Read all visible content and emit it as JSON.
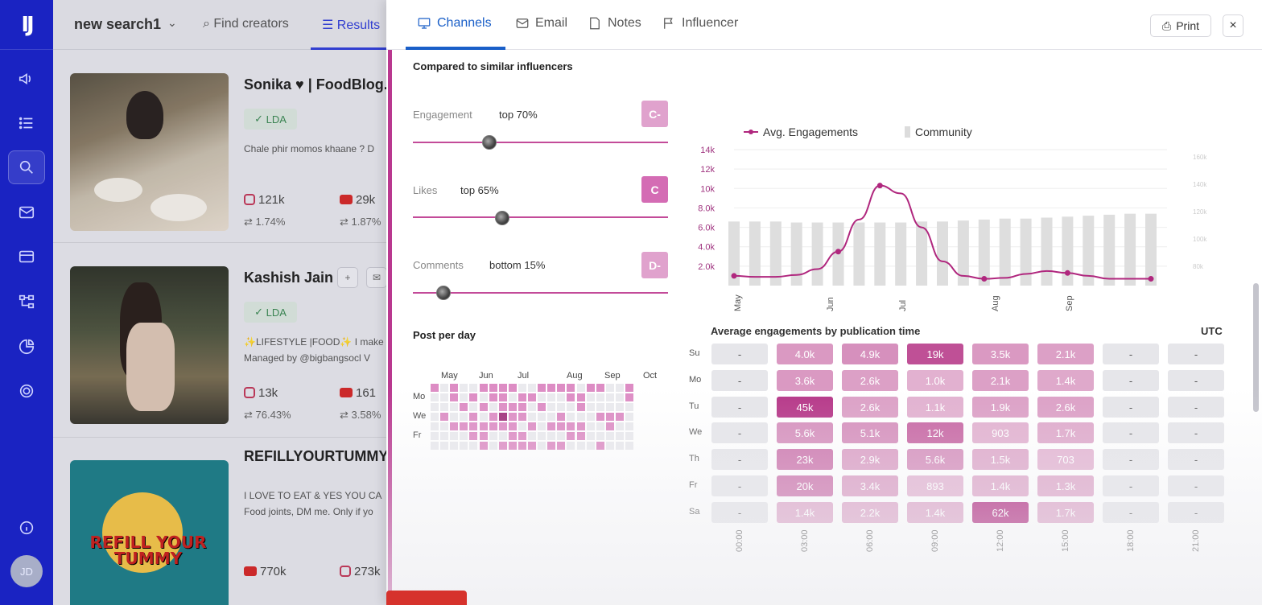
{
  "sidebar": {
    "logo": "IJ",
    "avatar_initials": "JD"
  },
  "results": {
    "search_name": "new search1",
    "find_tab": "Find creators",
    "results_tab": "Results",
    "cards": [
      {
        "name": "Sonika ♥ | FoodBlog...",
        "badge": "LDA",
        "bio": "Chale phir momos khaane ? D",
        "bio2": "",
        "ig_followers": "121k",
        "yt_followers": "29k",
        "ig_engagement": "1.74%",
        "yt_engagement": "1.87%"
      },
      {
        "name": "Kashish Jain",
        "badge": "LDA",
        "bio": "✨LIFESTYLE |FOOD✨ I make",
        "bio2": "Managed by @bigbangsocl V",
        "ig_followers": "13k",
        "yt_followers": "161",
        "ig_engagement": "76.43%",
        "yt_engagement": "3.58%"
      },
      {
        "name": "REFILLYOURTUMMY",
        "badge": "",
        "bio": "I LOVE TO EAT & YES YOU CA",
        "bio2": "Food joints, DM me. Only if yo",
        "yt_followers": "770k",
        "ig_followers": "273k"
      }
    ],
    "card3_image_text": "REFILL YOUR TUMMY"
  },
  "drawer": {
    "tabs": [
      "Channels",
      "Email",
      "Notes",
      "Influencer"
    ],
    "print_label": "Print",
    "close_label": "×",
    "compared_title": "Compared to similar influencers",
    "metrics": [
      {
        "label": "Engagement",
        "value": "top 70%",
        "grade": "C-",
        "position": 0.3
      },
      {
        "label": "Likes",
        "value": "top 65%",
        "grade": "C",
        "position": 0.35
      },
      {
        "label": "Comments",
        "value": "bottom 15%",
        "grade": "D-",
        "position": 0.12
      }
    ],
    "post_per_day_title": "Post per day",
    "calendar": {
      "months": [
        "May",
        "Jun",
        "Jul",
        "Aug",
        "Sep",
        "Oct"
      ],
      "days": [
        "Mo",
        "We",
        "Fr"
      ]
    }
  },
  "chart_data": {
    "type": "line",
    "legend": [
      "Avg. Engagements",
      "Community"
    ],
    "x_ticks": [
      "May",
      "Jun",
      "Jul",
      "Aug",
      "Sep"
    ],
    "y_ticks": [
      "2.0k",
      "4.0k",
      "6.0k",
      "8.0k",
      "10k",
      "12k",
      "14k"
    ],
    "ylim": [
      0,
      14000
    ],
    "series": [
      {
        "name": "Avg. Engagements",
        "x": [
          0,
          0.25,
          0.5,
          0.75,
          1.0,
          1.25,
          1.5,
          1.75,
          2.0,
          2.25,
          2.5,
          2.75,
          3.0,
          3.25,
          3.5,
          3.75,
          4.0,
          4.25,
          4.5,
          4.75,
          5.0
        ],
        "values": [
          1000,
          900,
          900,
          1100,
          1700,
          3500,
          6800,
          10300,
          9500,
          6000,
          2500,
          1000,
          700,
          800,
          1200,
          1500,
          1300,
          1000,
          700,
          700,
          700
        ]
      },
      {
        "name": "Community",
        "values": [
          6600,
          6600,
          6600,
          6500,
          6500,
          6500,
          6500,
          6500,
          6500,
          6600,
          6600,
          6700,
          6800,
          6900,
          6900,
          7000,
          7100,
          7200,
          7300,
          7400,
          7400
        ]
      }
    ],
    "marker_indices": [
      0,
      5,
      7,
      12,
      16,
      20
    ],
    "secondary_ticks": [
      "160k",
      "140k",
      "120k",
      "100k",
      "80k"
    ]
  },
  "heatmap": {
    "title": "Average engagements by publication time",
    "timezone": "UTC",
    "rows": [
      "Su",
      "Mo",
      "Tu",
      "We",
      "Th",
      "Fr",
      "Sa"
    ],
    "cols": [
      "00:00",
      "03:00",
      "06:00",
      "09:00",
      "12:00",
      "15:00",
      "18:00",
      "21:00"
    ],
    "values": [
      [
        "-",
        "4.0k",
        "4.9k",
        "19k",
        "3.5k",
        "2.1k",
        "-",
        "-"
      ],
      [
        "-",
        "3.6k",
        "2.6k",
        "1.0k",
        "2.1k",
        "1.4k",
        "-",
        "-"
      ],
      [
        "-",
        "45k",
        "2.6k",
        "1.1k",
        "1.9k",
        "2.6k",
        "-",
        "-"
      ],
      [
        "-",
        "5.6k",
        "5.1k",
        "12k",
        "903",
        "1.7k",
        "-",
        "-"
      ],
      [
        "-",
        "23k",
        "2.9k",
        "5.6k",
        "1.5k",
        "703",
        "-",
        "-"
      ],
      [
        "-",
        "20k",
        "3.4k",
        "893",
        "1.4k",
        "1.3k",
        "-",
        "-"
      ],
      [
        "-",
        "1.4k",
        "2.2k",
        "1.4k",
        "62k",
        "1.7k",
        "-",
        "-"
      ]
    ],
    "intensity": [
      [
        0,
        0.3,
        0.35,
        0.75,
        0.3,
        0.25,
        0,
        0
      ],
      [
        0,
        0.3,
        0.25,
        0.15,
        0.25,
        0.2,
        0,
        0
      ],
      [
        0,
        0.9,
        0.25,
        0.15,
        0.25,
        0.25,
        0,
        0
      ],
      [
        0,
        0.35,
        0.35,
        0.6,
        0.15,
        0.2,
        0,
        0
      ],
      [
        0,
        0.5,
        0.25,
        0.35,
        0.2,
        0.12,
        0,
        0
      ],
      [
        0,
        0.5,
        0.25,
        0.12,
        0.2,
        0.2,
        0,
        0
      ],
      [
        0,
        0.2,
        0.2,
        0.2,
        0.95,
        0.2,
        0,
        0
      ]
    ],
    "accent_color": "#b0277e"
  }
}
